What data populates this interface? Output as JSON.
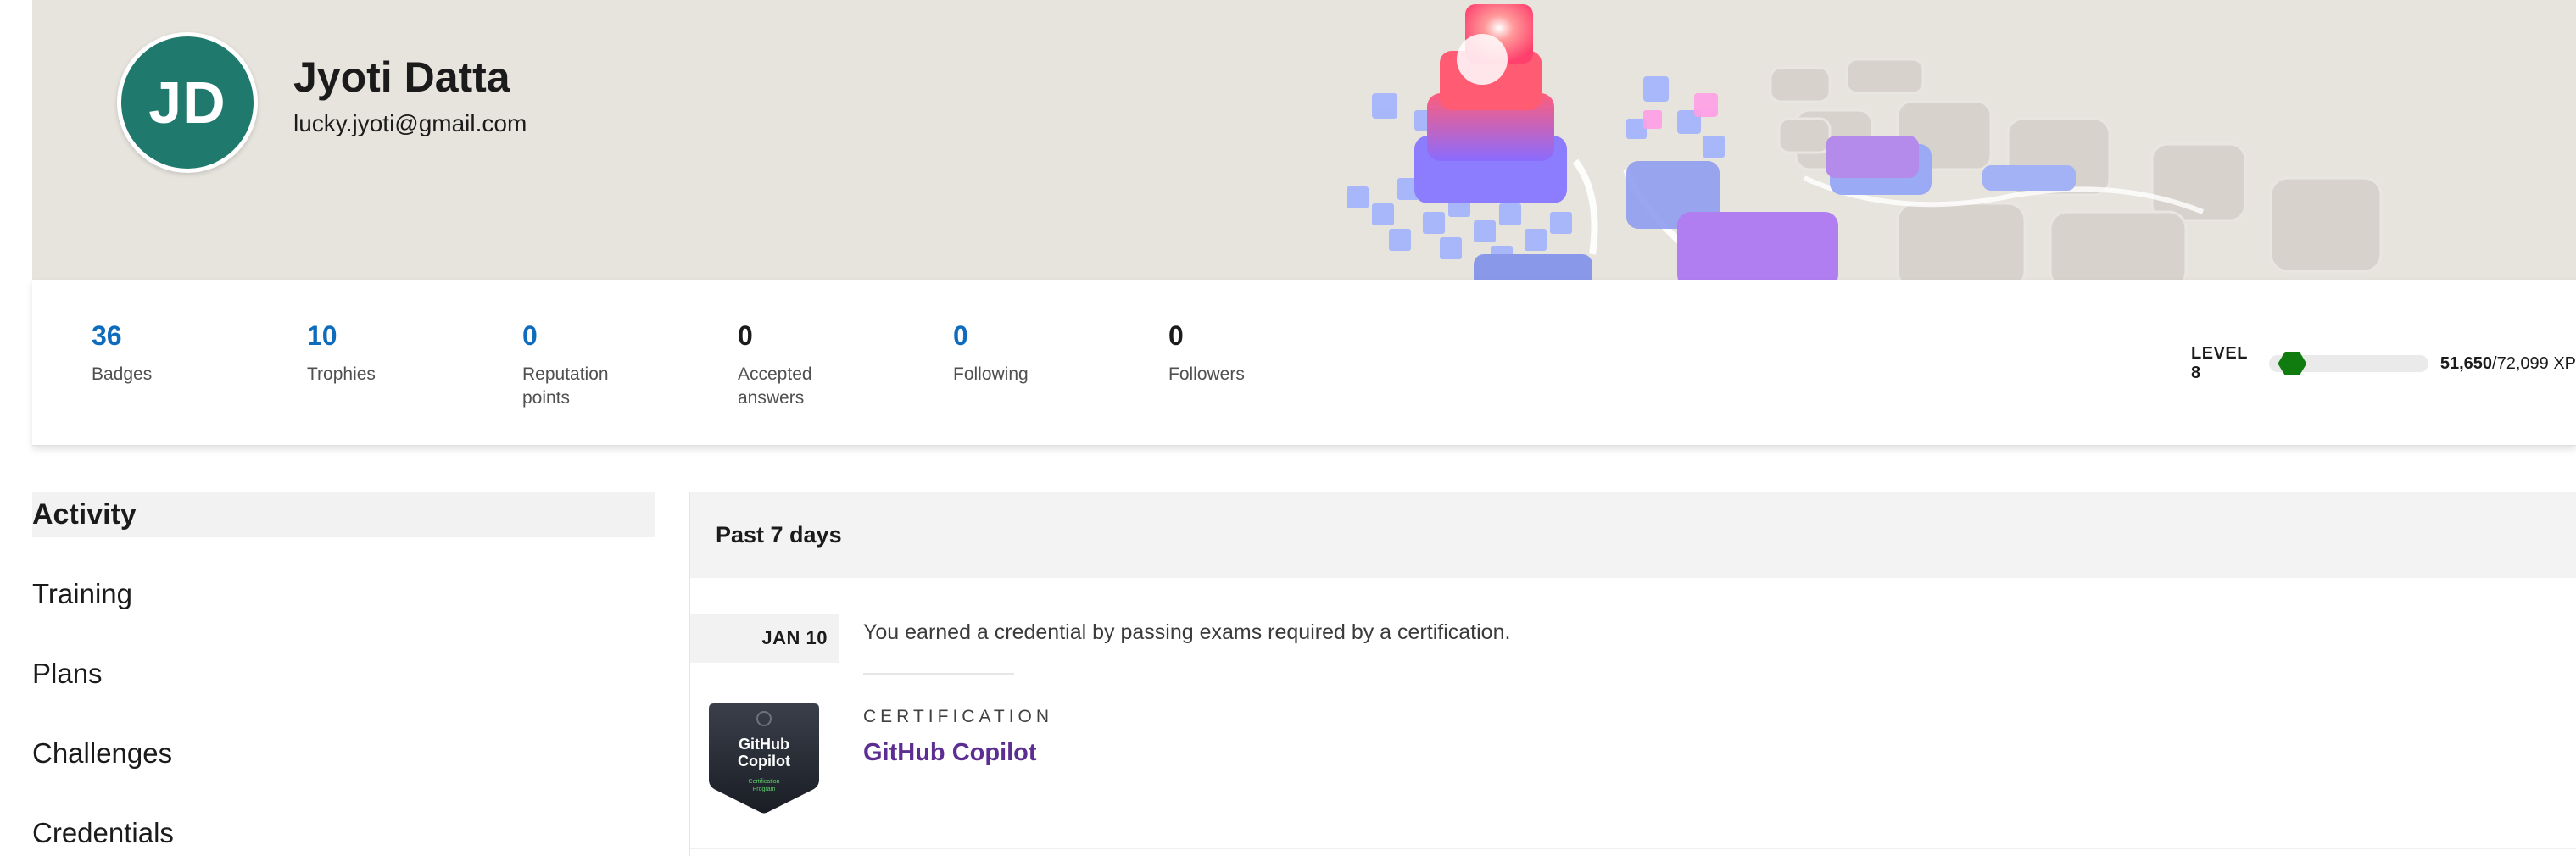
{
  "profile": {
    "initials": "JD",
    "name": "Jyoti Datta",
    "email": "lucky.jyoti@gmail.com",
    "avatar_color": "#1f7a6d"
  },
  "stats": [
    {
      "value": "36",
      "label": "Badges",
      "color": "#0f6cbd"
    },
    {
      "value": "10",
      "label": "Trophies",
      "color": "#0f6cbd"
    },
    {
      "value": "0",
      "label": "Reputation points",
      "color": "#0f6cbd"
    },
    {
      "value": "0",
      "label": "Accepted answers",
      "color": "#1b1b1b"
    },
    {
      "value": "0",
      "label": "Following",
      "color": "#0f6cbd"
    },
    {
      "value": "0",
      "label": "Followers",
      "color": "#1b1b1b"
    }
  ],
  "level": {
    "label": "LEVEL 8",
    "xp_current": "51,650",
    "xp_total": "/72,099 XP",
    "progress_fraction": 0.14,
    "bar_color": "#107c10"
  },
  "nav": {
    "items": [
      {
        "label": "Activity",
        "active": true
      },
      {
        "label": "Training",
        "active": false
      },
      {
        "label": "Plans",
        "active": false
      },
      {
        "label": "Challenges",
        "active": false
      },
      {
        "label": "Credentials",
        "active": false
      }
    ]
  },
  "activity": {
    "period": "Past 7 days",
    "entries": [
      {
        "date": "JAN 10",
        "text": "You earned a credential by passing exams required by a certification.",
        "kicker": "CERTIFICATION",
        "title": "GitHub Copilot",
        "badge": {
          "line1": "GitHub",
          "line2": "Copilot",
          "line3": "Certification",
          "line4": "Program"
        }
      }
    ]
  }
}
